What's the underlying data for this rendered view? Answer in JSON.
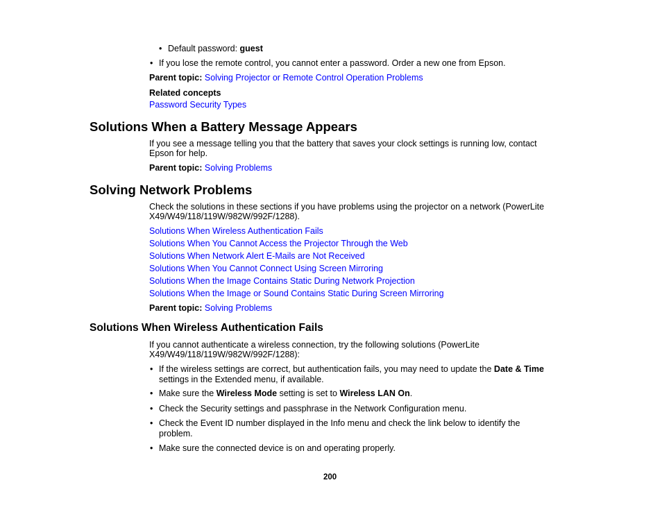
{
  "top": {
    "sub_bullet_prefix": "Default password: ",
    "sub_bullet_bold": "guest",
    "bullet_text": "If you lose the remote control, you cannot enter a password. Order a new one from Epson.",
    "parent_topic_label": "Parent topic:",
    "parent_topic_link": "Solving Projector or Remote Control Operation Problems",
    "related_concepts_label": "Related concepts",
    "related_concepts_link": "Password Security Types"
  },
  "battery": {
    "heading": "Solutions When a Battery Message Appears",
    "body_line1": "If you see a message telling you that the battery that saves your clock settings is running low, contact",
    "body_line2": "Epson for help.",
    "parent_topic_label": "Parent topic:",
    "parent_topic_link": "Solving Problems"
  },
  "network": {
    "heading": "Solving Network Problems",
    "body_line1": "Check the solutions in these sections if you have problems using the projector on a network (PowerLite",
    "body_line2": "X49/W49/118/119W/982W/992F/1288).",
    "links": [
      "Solutions When Wireless Authentication Fails",
      "Solutions When You Cannot Access the Projector Through the Web",
      "Solutions When Network Alert E-Mails are Not Received",
      "Solutions When You Cannot Connect Using Screen Mirroring",
      "Solutions When the Image Contains Static During Network Projection",
      "Solutions When the Image or Sound Contains Static During Screen Mirroring"
    ],
    "parent_topic_label": "Parent topic:",
    "parent_topic_link": "Solving Problems"
  },
  "wireless": {
    "heading": "Solutions When Wireless Authentication Fails",
    "body_line1": "If you cannot authenticate a wireless connection, try the following solutions (PowerLite",
    "body_line2": "X49/W49/118/119W/982W/992F/1288):",
    "bullet1_a": "If the wireless settings are correct, but authentication fails, you may need to update the ",
    "bullet1_bold": "Date & Time",
    "bullet1_b": "settings in the Extended menu, if available.",
    "bullet2_a": "Make sure the ",
    "bullet2_bold1": "Wireless Mode",
    "bullet2_b": " setting is set to ",
    "bullet2_bold2": "Wireless LAN On",
    "bullet2_c": ".",
    "bullet3": "Check the Security settings and passphrase in the Network Configuration menu.",
    "bullet4_line1": "Check the Event ID number displayed in the Info menu and check the link below to identify the",
    "bullet4_line2": "problem.",
    "bullet5": "Make sure the connected device is on and operating properly."
  },
  "footer": {
    "page_number": "200"
  },
  "bullet_glyph": "•"
}
